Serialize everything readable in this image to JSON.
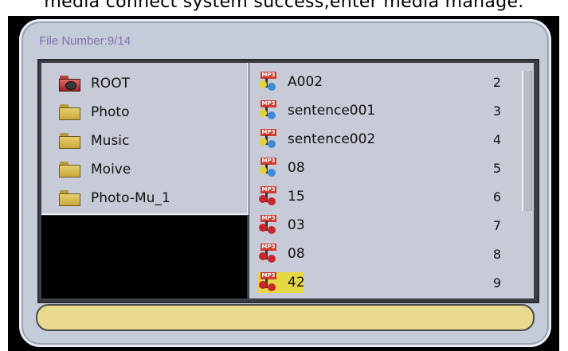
{
  "header": {
    "message": "media connect system success,enter media manage."
  },
  "browser": {
    "file_number_label": "File Number:9/14"
  },
  "folders": [
    {
      "label": "ROOT",
      "icon": "root-drive-icon"
    },
    {
      "label": "Photo",
      "icon": "folder-icon"
    },
    {
      "label": "Music",
      "icon": "folder-icon"
    },
    {
      "label": "Moive",
      "icon": "folder-icon"
    },
    {
      "label": "Photo-Mu_1",
      "icon": "folder-icon"
    }
  ],
  "files": [
    {
      "name": "A002",
      "index": "2",
      "icon": "mp3-file-icon",
      "selected": false
    },
    {
      "name": "sentence001",
      "index": "3",
      "icon": "mp3-file-icon",
      "selected": false
    },
    {
      "name": "sentence002",
      "index": "4",
      "icon": "mp3-file-icon",
      "selected": false
    },
    {
      "name": "08",
      "index": "5",
      "icon": "mp3-file-icon",
      "selected": false
    },
    {
      "name": "15",
      "index": "6",
      "icon": "mp3-file-icon",
      "selected": false
    },
    {
      "name": "03",
      "index": "7",
      "icon": "mp3-file-icon",
      "selected": false
    },
    {
      "name": "08",
      "index": "8",
      "icon": "mp3-file-icon",
      "selected": false
    },
    {
      "name": "42",
      "index": "9",
      "icon": "mp3-file-icon",
      "selected": true
    }
  ],
  "colors": {
    "selection": "#e7d643",
    "frame": "#c4cbd9",
    "status_bar": "#e8d98e",
    "file_number_text": "#8270ae"
  }
}
